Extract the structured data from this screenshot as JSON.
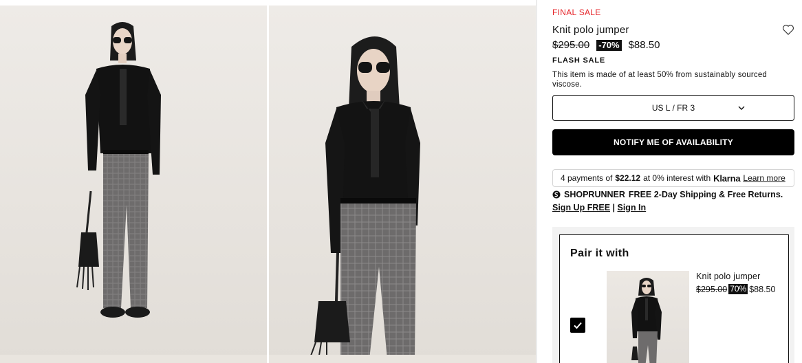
{
  "product": {
    "sale_label": "FINAL SALE",
    "title": "Knit polo jumper",
    "old_price": "$295.00",
    "discount": "-70%",
    "new_price": "$88.50",
    "flash_label": "FLASH SALE",
    "eco_note": "This item is made of at least 50% from sustainably sourced viscose.",
    "size_selected": "US L / FR 3",
    "notify_button": "NOTIFY ME OF AVAILABILITY"
  },
  "klarna": {
    "prefix": "4 payments of",
    "amount": "$22.12",
    "suffix": "at 0% interest with",
    "logo": "Klarna",
    "link": "Learn more"
  },
  "shoprunner": {
    "brand": "SHOPRUNNER",
    "text": "FREE 2-Day Shipping & Free Returns.",
    "signup": "Sign Up FREE",
    "separator": "|",
    "signin": "Sign In"
  },
  "pair": {
    "heading": "Pair it with",
    "item_name": "Knit polo jumper",
    "old_price": "$295.00",
    "discount": "70%",
    "new_price": "$88.50",
    "checked": true
  },
  "colors": {
    "sale_red": "#e5252a",
    "black": "#000000",
    "panel_gray": "#f2f2f2"
  },
  "icons": [
    "heart-icon",
    "chevron-down-icon",
    "shoprunner-icon",
    "checkmark-icon"
  ]
}
